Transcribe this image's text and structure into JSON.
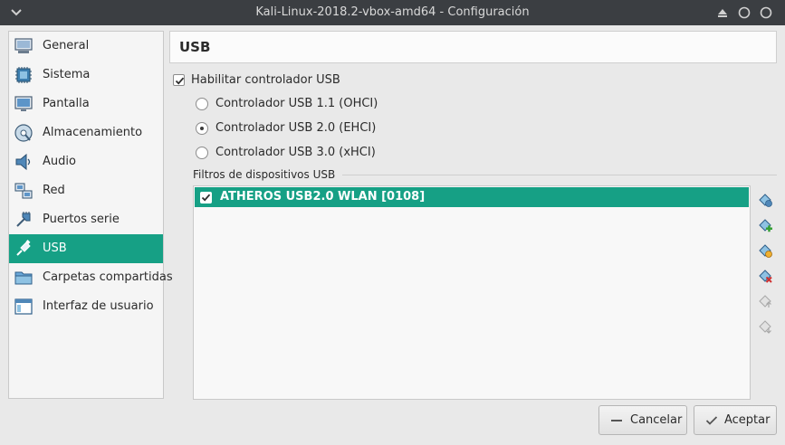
{
  "window": {
    "title": "Kali-Linux-2018.2-vbox-amd64 - Configuración"
  },
  "sidebar": {
    "items": [
      {
        "label": "General",
        "icon": "monitor-icon"
      },
      {
        "label": "Sistema",
        "icon": "chip-icon"
      },
      {
        "label": "Pantalla",
        "icon": "display-icon"
      },
      {
        "label": "Almacenamiento",
        "icon": "disk-icon"
      },
      {
        "label": "Audio",
        "icon": "speaker-icon"
      },
      {
        "label": "Red",
        "icon": "network-icon"
      },
      {
        "label": "Puertos serie",
        "icon": "serial-port-icon"
      },
      {
        "label": "USB",
        "icon": "usb-icon",
        "active": true
      },
      {
        "label": "Carpetas compartidas",
        "icon": "folder-icon"
      },
      {
        "label": "Interfaz de usuario",
        "icon": "window-icon"
      }
    ]
  },
  "page": {
    "title": "USB"
  },
  "usb": {
    "enable_label": "Habilitar controlador USB",
    "enable_checked": true,
    "controllers": [
      {
        "label": "Controlador USB 1.1 (OHCI)",
        "selected": false
      },
      {
        "label": "Controlador USB 2.0 (EHCI)",
        "selected": true
      },
      {
        "label": "Controlador USB 3.0 (xHCI)",
        "selected": false
      }
    ],
    "filters_label": "Filtros de dispositivos USB",
    "filters": [
      {
        "label": "ATHEROS USB2.0 WLAN [0108]",
        "checked": true
      }
    ]
  },
  "filter_tools": [
    "add-filter-icon",
    "add-from-device-icon",
    "edit-filter-icon",
    "remove-filter-icon",
    "move-up-icon",
    "move-down-icon"
  ],
  "buttons": {
    "cancel": "Cancelar",
    "accept": "Aceptar"
  },
  "colors": {
    "accent": "#16a085",
    "titlebar": "#3b3e42"
  }
}
